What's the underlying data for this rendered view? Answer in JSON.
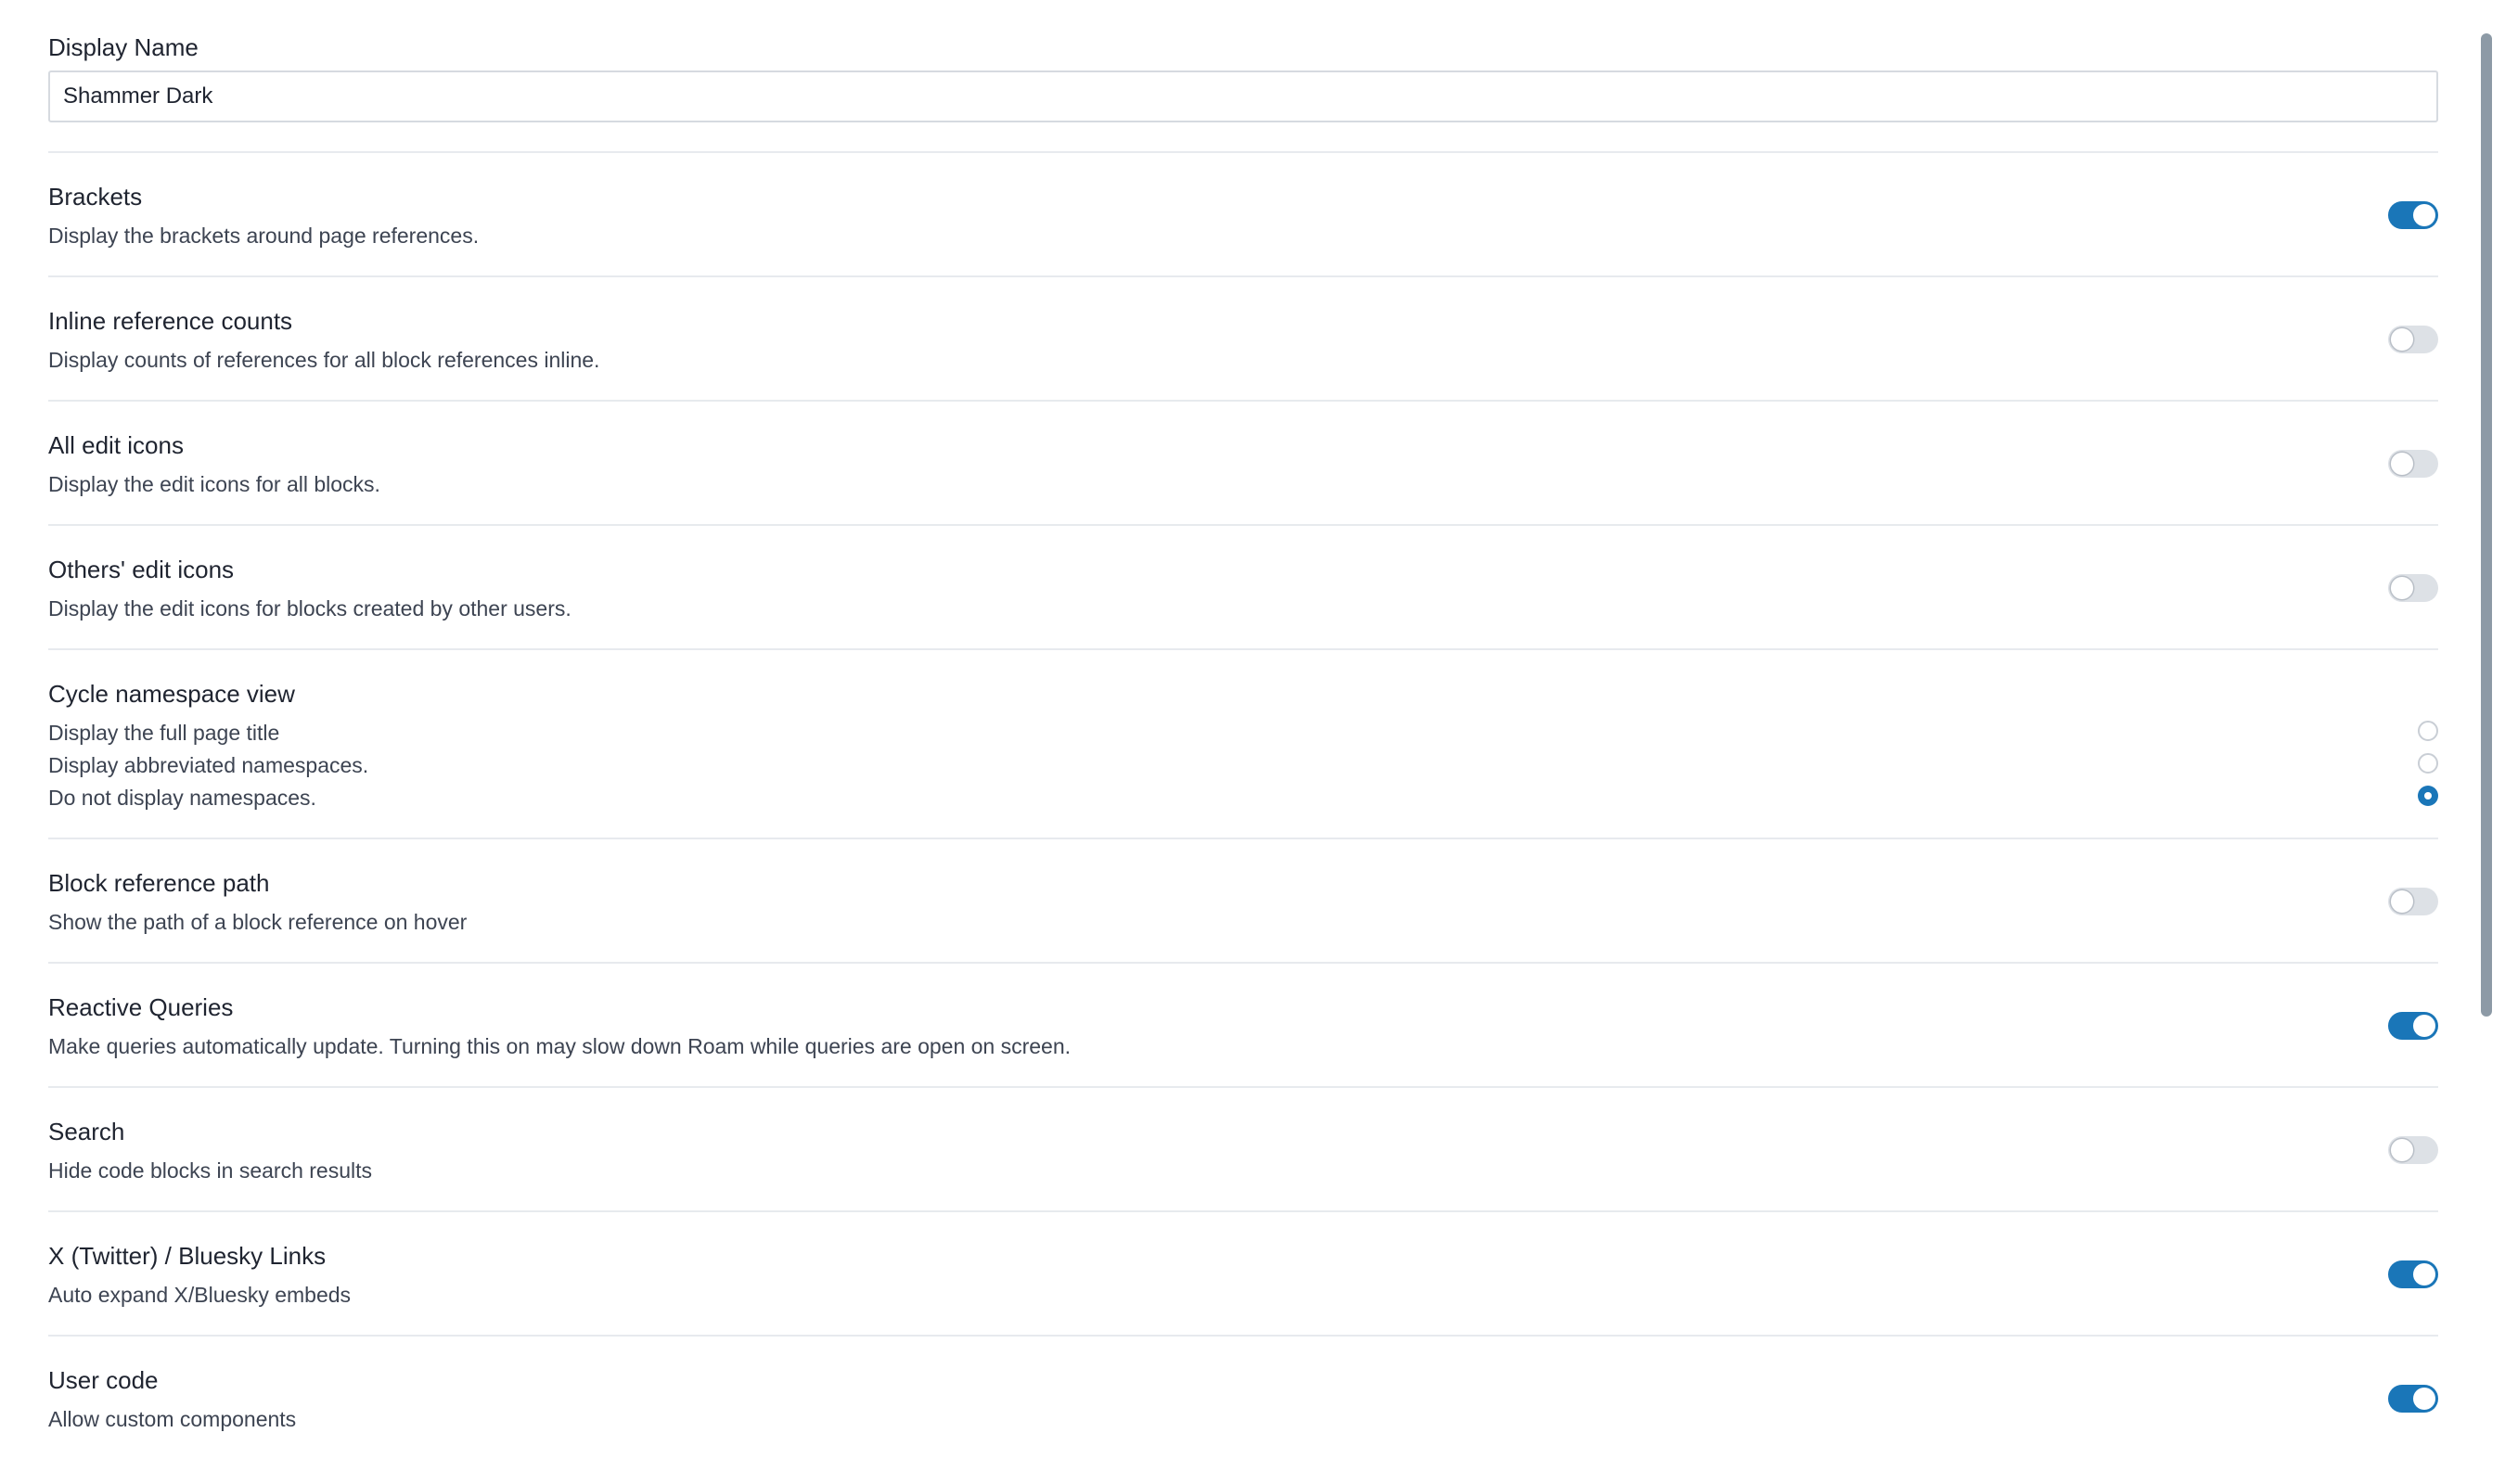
{
  "display_name": {
    "label": "Display Name",
    "value": "Shammer Dark"
  },
  "settings": [
    {
      "title": "Brackets",
      "description": "Display the brackets around page references.",
      "enabled": true
    },
    {
      "title": "Inline reference counts",
      "description": "Display counts of references for all block references inline.",
      "enabled": false
    },
    {
      "title": "All edit icons",
      "description": "Display the edit icons for all blocks.",
      "enabled": false
    },
    {
      "title": "Others' edit icons",
      "description": "Display the edit icons for blocks created by other users.",
      "enabled": false
    }
  ],
  "namespace": {
    "title": "Cycle namespace view",
    "options": [
      {
        "label": "Display the full page title",
        "selected": false
      },
      {
        "label": "Display abbreviated namespaces.",
        "selected": false
      },
      {
        "label": "Do not display namespaces.",
        "selected": true
      }
    ]
  },
  "settings2": [
    {
      "title": "Block reference path",
      "description": "Show the path of a block reference on hover",
      "enabled": false
    },
    {
      "title": "Reactive Queries",
      "description": "Make queries automatically update. Turning this on may slow down Roam while queries are open on screen.",
      "enabled": true
    },
    {
      "title": "Search",
      "description": "Hide code blocks in search results",
      "enabled": false
    },
    {
      "title": "X (Twitter) / Bluesky Links",
      "description": "Auto expand X/Bluesky embeds",
      "enabled": true
    },
    {
      "title": "User code",
      "description": "Allow custom components",
      "enabled": true
    }
  ],
  "colors": {
    "accent": "#1a76b8",
    "toggle_off": "#dde1e6",
    "divider": "#e7eaee",
    "scrollbar": "#8d9aa6"
  }
}
